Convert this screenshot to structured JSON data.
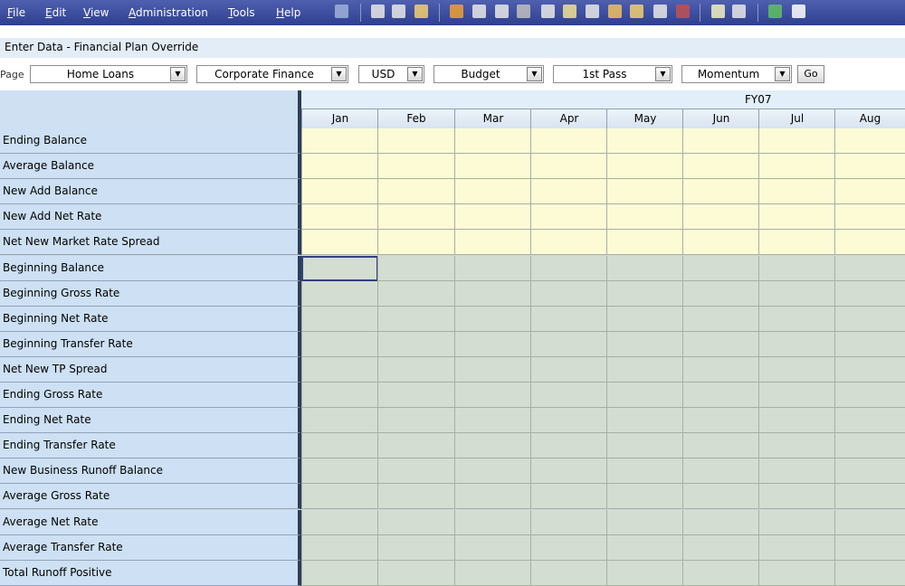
{
  "menu": {
    "items": [
      {
        "underline": "F",
        "rest": "ile"
      },
      {
        "underline": "E",
        "rest": "dit"
      },
      {
        "underline": "V",
        "rest": "iew"
      },
      {
        "underline": "A",
        "rest": "dministration"
      },
      {
        "underline": "T",
        "rest": "ools"
      },
      {
        "underline": "H",
        "rest": "elp"
      }
    ]
  },
  "toolbar_icons": [
    "explorer-icon",
    "save-icon",
    "refresh-icon",
    "print-icon",
    "edit-icon",
    "lock-icon",
    "chart-icon",
    "cut-icon",
    "copy-icon",
    "paste-icon",
    "calculator-icon",
    "grid-icon",
    "spreadsheet-icon",
    "settings-icon",
    "pin-icon",
    "document-icon",
    "report-icon",
    "exit-icon",
    "help-icon"
  ],
  "page_title": "Enter Data - Financial Plan Override",
  "pov": {
    "label": "Page",
    "selections": [
      "Home Loans",
      "Corporate Finance",
      "USD",
      "Budget",
      "1st Pass",
      "Momentum"
    ],
    "go_label": "Go"
  },
  "grid": {
    "period_header": "FY07",
    "months": [
      "Jan",
      "Feb",
      "Mar",
      "Apr",
      "May",
      "Jun",
      "Jul",
      "Aug"
    ],
    "rows": [
      {
        "label": "Ending Balance",
        "type": "input"
      },
      {
        "label": "Average Balance",
        "type": "input"
      },
      {
        "label": "New Add Balance",
        "type": "input"
      },
      {
        "label": "New Add Net Rate",
        "type": "input"
      },
      {
        "label": "Net New Market Rate Spread",
        "type": "input"
      },
      {
        "label": "Beginning Balance",
        "type": "calc"
      },
      {
        "label": "Beginning Gross Rate",
        "type": "calc"
      },
      {
        "label": "Beginning Net Rate",
        "type": "calc"
      },
      {
        "label": "Beginning Transfer Rate",
        "type": "calc"
      },
      {
        "label": "Net New TP Spread",
        "type": "calc"
      },
      {
        "label": "Ending Gross Rate",
        "type": "calc"
      },
      {
        "label": "Ending Net Rate",
        "type": "calc"
      },
      {
        "label": "Ending Transfer Rate",
        "type": "calc"
      },
      {
        "label": "New Business Runoff Balance",
        "type": "calc"
      },
      {
        "label": "Average Gross Rate",
        "type": "calc"
      },
      {
        "label": "Average Net Rate",
        "type": "calc"
      },
      {
        "label": "Average Transfer Rate",
        "type": "calc"
      },
      {
        "label": "Total Runoff Positive",
        "type": "calc"
      }
    ]
  },
  "colors": {
    "menu_bar": "#3a4a9e",
    "input_cell": "#fdfbd6",
    "calc_cell": "#d3ddd2",
    "row_header": "#cde0f4"
  }
}
